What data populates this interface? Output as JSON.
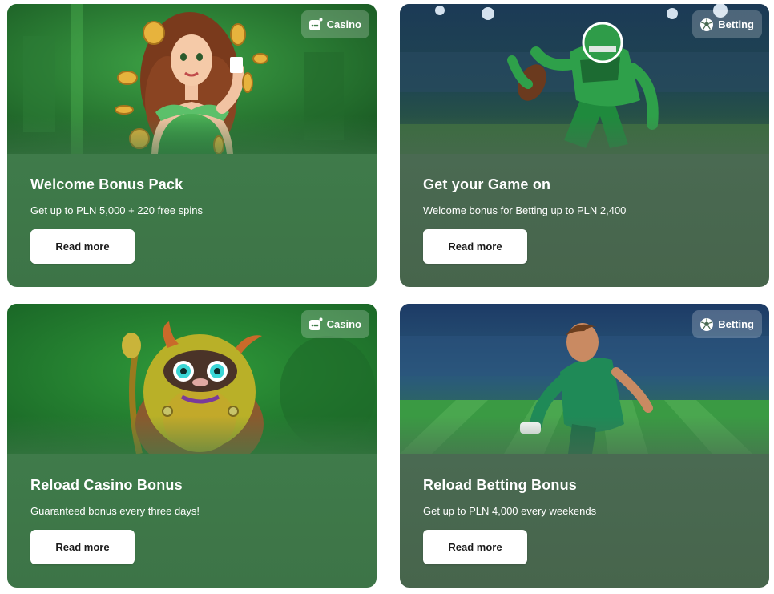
{
  "cards": [
    {
      "category": "Casino",
      "category_icon": "casino-chip-icon",
      "title": "Welcome Bonus Pack",
      "subtitle": "Get up to PLN 5,000 + 220 free spins",
      "button": "Read more",
      "art": "woman-with-coins-illustration"
    },
    {
      "category": "Betting",
      "category_icon": "soccer-ball-icon",
      "title": "Get your Game on",
      "subtitle": "Welcome bonus for Betting up to PLN 2,400",
      "button": "Read more",
      "art": "football-player-illustration"
    },
    {
      "category": "Casino",
      "category_icon": "casino-chip-icon",
      "title": "Reload Casino Bonus",
      "subtitle": "Guaranteed bonus every three days!",
      "button": "Read more",
      "art": "furry-monster-illustration"
    },
    {
      "category": "Betting",
      "category_icon": "soccer-ball-icon",
      "title": "Reload Betting Bonus",
      "subtitle": "Get up to PLN 4,000 every weekends",
      "button": "Read more",
      "art": "soccer-player-illustration"
    }
  ],
  "colors": {
    "casino_panel": "#3f7b4a",
    "betting_panel": "#4a6a52",
    "button_bg": "#ffffff",
    "button_text": "#1b1b1b"
  }
}
